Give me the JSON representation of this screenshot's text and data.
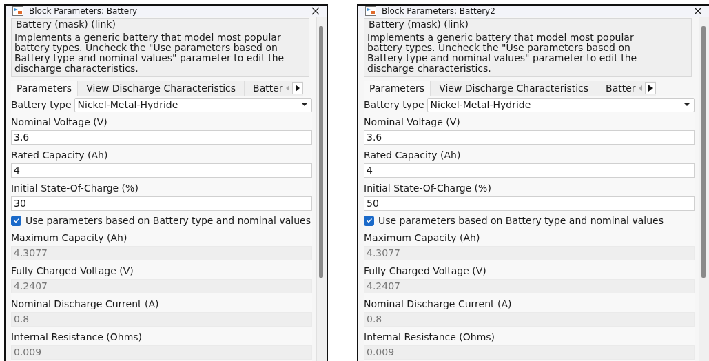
{
  "dialogs": [
    {
      "title": "Block Parameters: Battery",
      "group_title": "Battery (mask) (link)",
      "description": "Implements a generic battery that model most popular battery types. Uncheck the \"Use parameters based on Battery type and nominal values\" parameter to edit the discharge characteristics.",
      "tabs": [
        {
          "label": "Parameters",
          "selected": true
        },
        {
          "label": "View Discharge Characteristics",
          "selected": false
        },
        {
          "label": "Batter",
          "selected": false
        }
      ],
      "battery_type": {
        "label": "Battery type",
        "value": "Nickel-Metal-Hydride"
      },
      "params": [
        {
          "kind": "field",
          "label": "Nominal Voltage (V)",
          "value": "3.6",
          "disabled": false
        },
        {
          "kind": "field",
          "label": "Rated Capacity (Ah)",
          "value": "4",
          "disabled": false
        },
        {
          "kind": "field",
          "label": "Initial State-Of-Charge (%)",
          "value": "30",
          "disabled": false
        },
        {
          "kind": "checkbox",
          "label": "Use parameters based on Battery type and nominal values",
          "checked": true
        },
        {
          "kind": "field",
          "label": "Maximum Capacity (Ah)",
          "value": "4.3077",
          "disabled": true
        },
        {
          "kind": "field",
          "label": "Fully Charged Voltage (V)",
          "value": "4.2407",
          "disabled": true
        },
        {
          "kind": "field",
          "label": "Nominal Discharge Current (A)",
          "value": "0.8",
          "disabled": true
        },
        {
          "kind": "field",
          "label": "Internal Resistance (Ohms)",
          "value": "0.009",
          "disabled": true
        }
      ]
    },
    {
      "title": "Block Parameters: Battery2",
      "group_title": "Battery (mask) (link)",
      "description": "Implements a generic battery that model most popular battery types. Uncheck the \"Use parameters based on Battery type and nominal values\" parameter to edit the discharge characteristics.",
      "tabs": [
        {
          "label": "Parameters",
          "selected": true
        },
        {
          "label": "View Discharge Characteristics",
          "selected": false
        },
        {
          "label": "Batter",
          "selected": false
        }
      ],
      "battery_type": {
        "label": "Battery type",
        "value": "Nickel-Metal-Hydride"
      },
      "params": [
        {
          "kind": "field",
          "label": "Nominal Voltage (V)",
          "value": "3.6",
          "disabled": false
        },
        {
          "kind": "field",
          "label": "Rated Capacity (Ah)",
          "value": "4",
          "disabled": false
        },
        {
          "kind": "field",
          "label": "Initial State-Of-Charge (%)",
          "value": "50",
          "disabled": false
        },
        {
          "kind": "checkbox",
          "label": "Use parameters based on Battery type and nominal values",
          "checked": true
        },
        {
          "kind": "field",
          "label": "Maximum Capacity (Ah)",
          "value": "4.3077",
          "disabled": true
        },
        {
          "kind": "field",
          "label": "Fully Charged Voltage (V)",
          "value": "4.2407",
          "disabled": true
        },
        {
          "kind": "field",
          "label": "Nominal Discharge Current (A)",
          "value": "0.8",
          "disabled": true
        },
        {
          "kind": "field",
          "label": "Internal Resistance (Ohms)",
          "value": "0.009",
          "disabled": true
        }
      ]
    }
  ]
}
